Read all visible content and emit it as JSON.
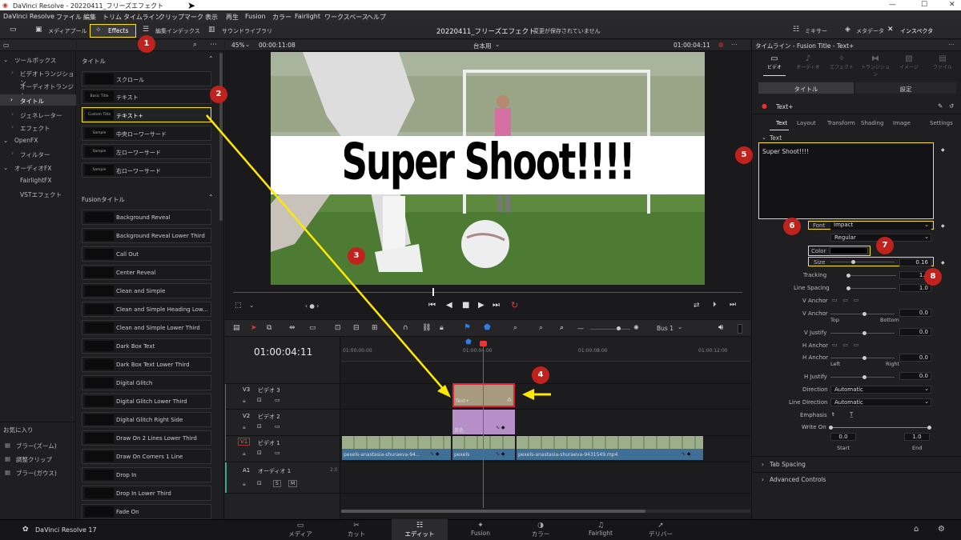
{
  "window": {
    "title": "DaVinci Resolve - 20220411_フリーズエフェクト",
    "min": "—",
    "max": "☐",
    "close": "✕"
  },
  "menu": [
    "DaVinci Resolve",
    "ファイル",
    "編集",
    "トリム",
    "タイムライン",
    "クリップ",
    "マーク",
    "表示",
    "再生",
    "Fusion",
    "カラー",
    "Fairlight",
    "ワークスペース",
    "ヘルプ"
  ],
  "toolbar": {
    "media_pool": "メディアプール",
    "effects": "Effects",
    "edit_index": "編集インデックス",
    "sound_library": "サウンドライブラリ",
    "project": "20220411_フリーズエフェクト",
    "unsaved": "変更が保存されていません",
    "mixer": "ミキサー",
    "metadata": "メタデータ",
    "inspector": "インスペクタ"
  },
  "left_tree": {
    "toolbox": "ツールボックス",
    "video_transitions": "ビデオトランジション",
    "audio_transitions": "オーディオトランジシ...",
    "titles": "タイトル",
    "generators": "ジェネレーター",
    "effects": "エフェクト",
    "openfx": "OpenFX",
    "filters": "フィルター",
    "audiofx": "オーディオFX",
    "fairlightfx": "FairlightFX",
    "vst": "VSTエフェクト",
    "favorites": "お気に入り",
    "fav_items": [
      "ブラー(ズーム)",
      "調整クリップ",
      "ブラー(ガウス)"
    ]
  },
  "titles_panel": {
    "header": "タイトル",
    "items": [
      {
        "thumb": "",
        "label": "スクロール"
      },
      {
        "thumb": "Basic Title",
        "label": "テキスト"
      },
      {
        "thumb": "Custom Title",
        "label": "テキスト+"
      },
      {
        "thumb": "Sample",
        "label": "中央ローワーサード"
      },
      {
        "thumb": "Sample",
        "label": "左ローワーサード"
      },
      {
        "thumb": "Sample",
        "label": "右ローワーサード"
      }
    ],
    "fusion_header": "Fusionタイトル",
    "fusion_items": [
      "Background Reveal",
      "Background Reveal Lower Third",
      "Call Out",
      "Center Reveal",
      "Clean and Simple",
      "Clean and Simple Heading Low...",
      "Clean and Simple Lower Third",
      "Dark Box Text",
      "Dark Box Text Lower Third",
      "Digital Glitch",
      "Digital Glitch Lower Third",
      "Digital Glitch Right Side",
      "Draw On 2 Lines Lower Third",
      "Draw On Corners 1 Line",
      "Drop In",
      "Drop In Lower Third",
      "Fade On"
    ]
  },
  "viewer": {
    "zoom": "45%",
    "src_tc": "00:00:11:08",
    "timeline_name": "台本用",
    "rec_tc": "01:00:04:11",
    "overlay_text": "Super Shoot!!!!"
  },
  "timeline": {
    "timecode": "01:00:04:11",
    "ruler": [
      "01:00:00:00",
      "01:00:04:00",
      "01:00:08:00",
      "01:00:12:00"
    ],
    "bus": "Bus 1",
    "tracks": [
      {
        "id": "V3",
        "name": "ビデオ 3"
      },
      {
        "id": "V2",
        "name": "ビデオ 2"
      },
      {
        "id": "V1",
        "name": "ビデオ 1"
      },
      {
        "id": "A1",
        "name": "オーディオ 1",
        "level": "2.0"
      }
    ],
    "clips": {
      "text_plus": "Text+",
      "color": "単色",
      "v1a": "pexels-anastasia-shuraeva-94...",
      "v1b": "pexels",
      "v1c": "pexels-anastasia-shuraeva-9431549.mp4"
    }
  },
  "inspector": {
    "title": "タイムライン - Fusion Title - Text+",
    "tabs": [
      "ビデオ",
      "オーディオ",
      "エフェクト",
      "トランジション",
      "イメージ",
      "ファイル"
    ],
    "sub_tabs": [
      "タイトル",
      "設定"
    ],
    "tool": "Text+",
    "text_tabs": [
      "Text",
      "Layout",
      "Transform",
      "Shading",
      "Image",
      "Settings"
    ],
    "section": "Text",
    "text_value": "Super Shoot!!!!",
    "font_label": "Font",
    "font": "Impact",
    "style": "Regular",
    "color_label": "Color",
    "color_value": "#000000",
    "size_label": "Size",
    "size": "0.16",
    "size_pos": 0.16,
    "tracking_label": "Tracking",
    "tracking": "1.0",
    "line_spacing_label": "Line Spacing",
    "line_spacing": "1.0",
    "v_anchor_label": "V Anchor",
    "v_anchor2_label": "V Anchor",
    "v_anchor": "0.0",
    "top": "Top",
    "bottom": "Bottom",
    "v_justify_label": "V Justify",
    "v_justify": "0.0",
    "h_anchor_label": "H Anchor",
    "h_anchor2_label": "H Anchor",
    "h_anchor": "0.0",
    "left": "Left",
    "right": "Right",
    "h_justify_label": "H Justify",
    "h_justify": "0.0",
    "direction_label": "Direction",
    "direction": "Automatic",
    "line_dir_label": "Line Direction",
    "line_dir": "Automatic",
    "emphasis_label": "Emphasis",
    "write_on_label": "Write On",
    "start": "0.0",
    "end": "1.0",
    "start_label": "Start",
    "end_label": "End",
    "tab_spacing": "Tab Spacing",
    "advanced": "Advanced Controls"
  },
  "pages": [
    {
      "icon": "▭",
      "label": "メディア"
    },
    {
      "icon": "✂",
      "label": "カット"
    },
    {
      "icon": "☷",
      "label": "エディット"
    },
    {
      "icon": "✦",
      "label": "Fusion"
    },
    {
      "icon": "◑",
      "label": "カラー"
    },
    {
      "icon": "♫",
      "label": "Fairlight"
    },
    {
      "icon": "➚",
      "label": "デリバー"
    }
  ],
  "app_name": "DaVinci Resolve 17",
  "callouts": [
    "1",
    "2",
    "3",
    "4",
    "5",
    "6",
    "7",
    "8"
  ]
}
